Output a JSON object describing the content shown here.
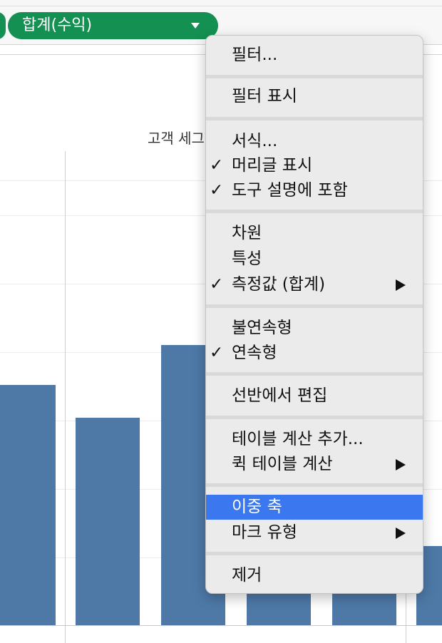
{
  "shelf": {
    "pill_label": "합계(수익)",
    "pill_color": "#149152"
  },
  "view": {
    "column_header": "고객 세그",
    "bar_color": "#4e79a7"
  },
  "context_menu": {
    "filter": "필터...",
    "show_filter": "필터 표시",
    "format": "서식...",
    "show_header": "머리글 표시",
    "include_tooltip": "도구 설명에 포함",
    "dimension": "차원",
    "attribute": "특성",
    "measure": "측정값 (합계)",
    "discrete": "불연속형",
    "continuous": "연속형",
    "edit_in_shelf": "선반에서 편집",
    "add_table_calc": "테이블 계산 추가...",
    "quick_table_calc": "퀵 테이블 계산",
    "dual_axis": "이중 축",
    "mark_type": "마크 유형",
    "remove": "제거",
    "check_glyph": "✓",
    "highlight_color": "#3b78f0"
  }
}
